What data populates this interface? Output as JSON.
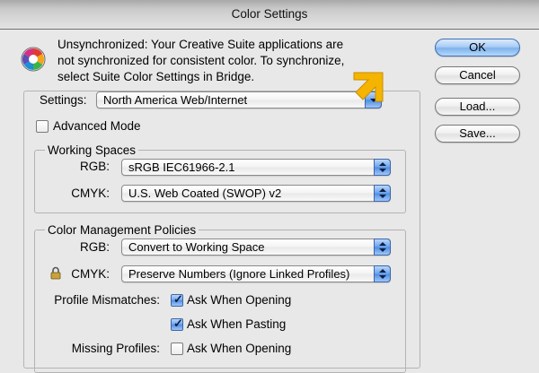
{
  "window": {
    "title": "Color Settings"
  },
  "notice": {
    "message": "Unsynchronized: Your Creative Suite applications are not synchronized for consistent color. To synchronize, select Suite Color Settings in Bridge."
  },
  "buttons": {
    "ok": "OK",
    "cancel": "Cancel",
    "load": "Load...",
    "save": "Save..."
  },
  "settings": {
    "label": "Settings:",
    "value": "North America Web/Internet",
    "advanced_mode_label": "Advanced Mode",
    "advanced_mode_checked": false
  },
  "working_spaces": {
    "title": "Working Spaces",
    "rgb_label": "RGB:",
    "rgb_value": "sRGB IEC61966-2.1",
    "cmyk_label": "CMYK:",
    "cmyk_value": "U.S. Web Coated (SWOP) v2"
  },
  "policies": {
    "title": "Color Management Policies",
    "rgb_label": "RGB:",
    "rgb_value": "Convert to Working Space",
    "cmyk_label": "CMYK:",
    "cmyk_value": "Preserve Numbers (Ignore Linked Profiles)",
    "profile_mismatches_label": "Profile Mismatches:",
    "ask_when_opening": "Ask When Opening",
    "ask_when_opening_checked": true,
    "ask_when_pasting": "Ask When Pasting",
    "ask_when_pasting_checked": true,
    "missing_profiles_label": "Missing Profiles:",
    "missing_ask_when_opening": "Ask When Opening",
    "missing_ask_when_opening_checked": false
  },
  "colors": {
    "annotation_arrow": "#f5b400",
    "accent": "#4d8ce4"
  },
  "icons": {
    "suite_logo": "color-wheel-icon",
    "annotation": "arrow-pointer-icon",
    "lock": "lock-icon"
  }
}
